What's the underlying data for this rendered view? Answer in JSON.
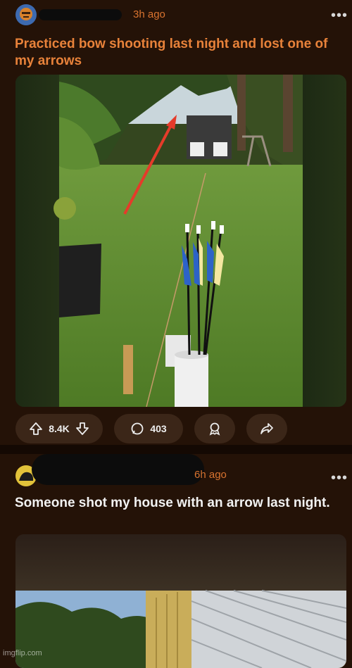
{
  "colors": {
    "background": "#241207",
    "accent_title": "#e8823a",
    "timestamp": "#d9732f",
    "pill_bg": "#3b2618"
  },
  "post1": {
    "time": "3h ago",
    "title": "Practiced bow shooting last night and lost one of my arrows",
    "upvotes": "8.4K",
    "comments": "403",
    "icons": [
      "upvote-icon",
      "downvote-icon",
      "comment-icon",
      "award-icon",
      "share-icon",
      "more-icon"
    ]
  },
  "post2": {
    "time": "6h ago",
    "title": "Someone shot my house with an arrow last night."
  },
  "watermark": "imgflip.com"
}
